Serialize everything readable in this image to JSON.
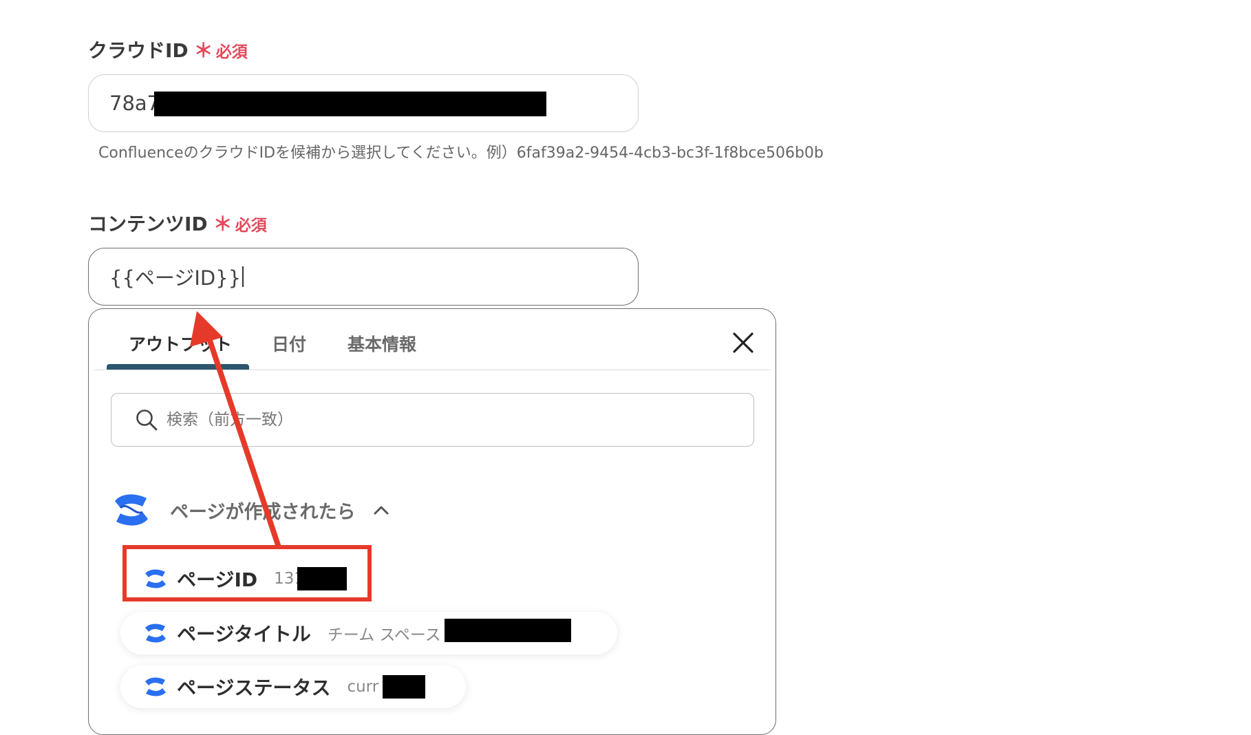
{
  "cloud_id": {
    "label": "クラウドID",
    "required_star": "＊",
    "required_text": "必須",
    "value": "78a7",
    "hint": "ConfluenceのクラウドIDを候補から選択してください。例）6faf39a2-9454-4cb3-bc3f-1f8bce506b0b"
  },
  "content_id": {
    "label": "コンテンツID",
    "required_star": "＊",
    "required_text": "必須",
    "value": "{{ページID}}"
  },
  "panel": {
    "tabs": [
      {
        "label": "アウトプット",
        "active": true
      },
      {
        "label": "日付"
      },
      {
        "label": "基本情報"
      }
    ],
    "search_placeholder": "検索（前方一致）",
    "group": {
      "title": "ページが作成されたら",
      "icon": "confluence-icon",
      "expanded": true
    },
    "items": [
      {
        "label": "ページID",
        "value": "131",
        "highlighted": true
      },
      {
        "label": "ページタイトル",
        "value": "チーム スペース"
      },
      {
        "label": "ページステータス",
        "value": "curr"
      }
    ]
  },
  "colors": {
    "required": "#e2495b",
    "tab_underline": "#2b566d",
    "highlight": "#e53a2a",
    "confluence_blue": "#2a6ff0"
  }
}
